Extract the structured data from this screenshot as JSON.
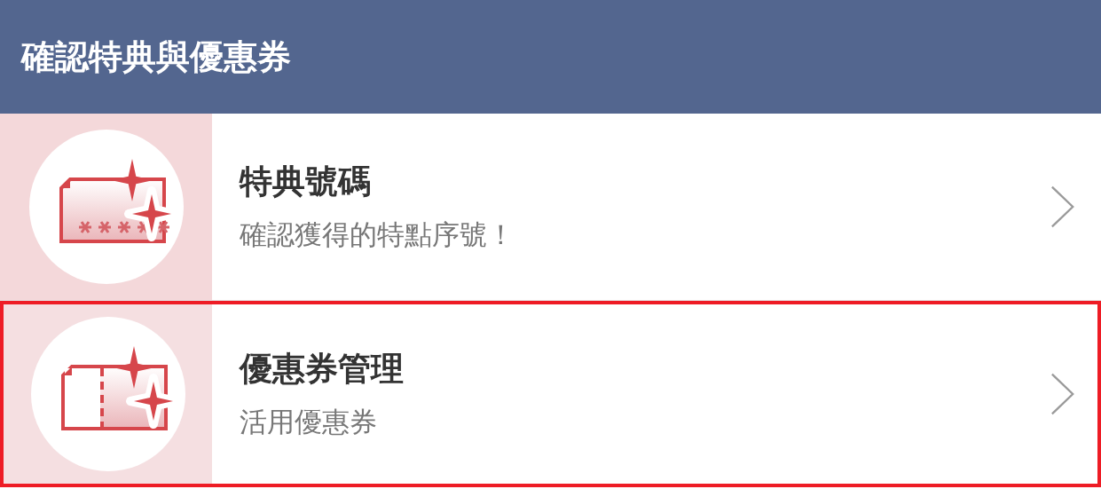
{
  "header": {
    "title": "確認特典與優惠券"
  },
  "items": [
    {
      "kind": "serial",
      "title": "特典號碼",
      "subtitle": "確認獲得的特點序號！",
      "highlighted": false
    },
    {
      "kind": "coupon",
      "title": "優惠券管理",
      "subtitle": "活用優惠券",
      "highlighted": true
    }
  ]
}
